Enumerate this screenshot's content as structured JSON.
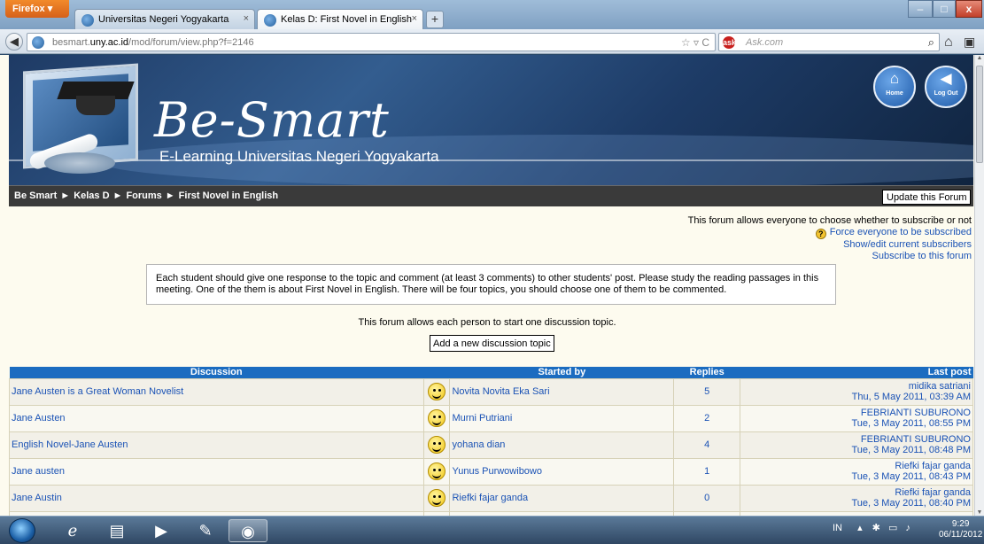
{
  "browser": {
    "app_button": "Firefox ▾",
    "tabs": [
      {
        "title": "Universitas Negeri Yogyakarta",
        "active": false
      },
      {
        "title": "Kelas D: First Novel in English",
        "active": true
      }
    ],
    "url_prefix": "besmart.",
    "url_domain": "uny.ac.id",
    "url_path": "/mod/forum/view.php?f=2146",
    "search_placeholder": "Ask.com",
    "search_engine_badge": "ask"
  },
  "banner": {
    "brand": "Be-Smart",
    "tagline": "E-Learning Universitas Negeri Yogyakarta",
    "home_label": "Home",
    "logout_label": "Log Out"
  },
  "breadcrumb": {
    "items": [
      "Be Smart",
      "Kelas D",
      "Forums",
      "First Novel in English"
    ],
    "separator": "►"
  },
  "update_button": "Update this Forum",
  "subscription": {
    "note": "This forum allows everyone to choose whether to subscribe or not",
    "force": "Force everyone to be subscribed",
    "show_edit": "Show/edit current subscribers",
    "subscribe": "Subscribe to this forum"
  },
  "intro": "Each student should give one response to the topic and comment (at least 3 comments) to other students' post. Please study the reading passages in this meeting. One of the them is about First Novel in English. There will be four topics, you should choose one of them to be commented.",
  "one_topic_note": "This forum allows each person to start one discussion topic.",
  "add_topic_button": "Add a new discussion topic",
  "table": {
    "headers": {
      "discussion": "Discussion",
      "started_by": "Started by",
      "replies": "Replies",
      "last_post": "Last post"
    },
    "rows": [
      {
        "discussion": "Jane Austen is a Great Woman Novelist",
        "started_by": "Novita Novita Eka Sari",
        "replies": "5",
        "last_name": "midika satriani",
        "last_date": "Thu, 5 May 2011, 03:39 AM"
      },
      {
        "discussion": "Jane Austen",
        "started_by": "Murni Putriani",
        "replies": "2",
        "last_name": "FEBRIANTI SUBURONO",
        "last_date": "Tue, 3 May 2011, 08:55 PM"
      },
      {
        "discussion": "English Novel-Jane Austen",
        "started_by": "yohana dian",
        "replies": "4",
        "last_name": "FEBRIANTI SUBURONO",
        "last_date": "Tue, 3 May 2011, 08:48 PM"
      },
      {
        "discussion": "Jane austen",
        "started_by": "Yunus Purwowibowo",
        "replies": "1",
        "last_name": "Riefki fajar ganda",
        "last_date": "Tue, 3 May 2011, 08:43 PM"
      },
      {
        "discussion": "Jane Austin",
        "started_by": "Riefki fajar ganda",
        "replies": "0",
        "last_name": "Riefki fajar ganda",
        "last_date": "Tue, 3 May 2011, 08:40 PM"
      }
    ]
  },
  "taskbar": {
    "language": "IN",
    "time": "9:29",
    "date": "06/11/2012"
  },
  "colors": {
    "link": "#1a52b5",
    "table_header": "#1b6cc0",
    "page_bg": "#fdfbef"
  }
}
